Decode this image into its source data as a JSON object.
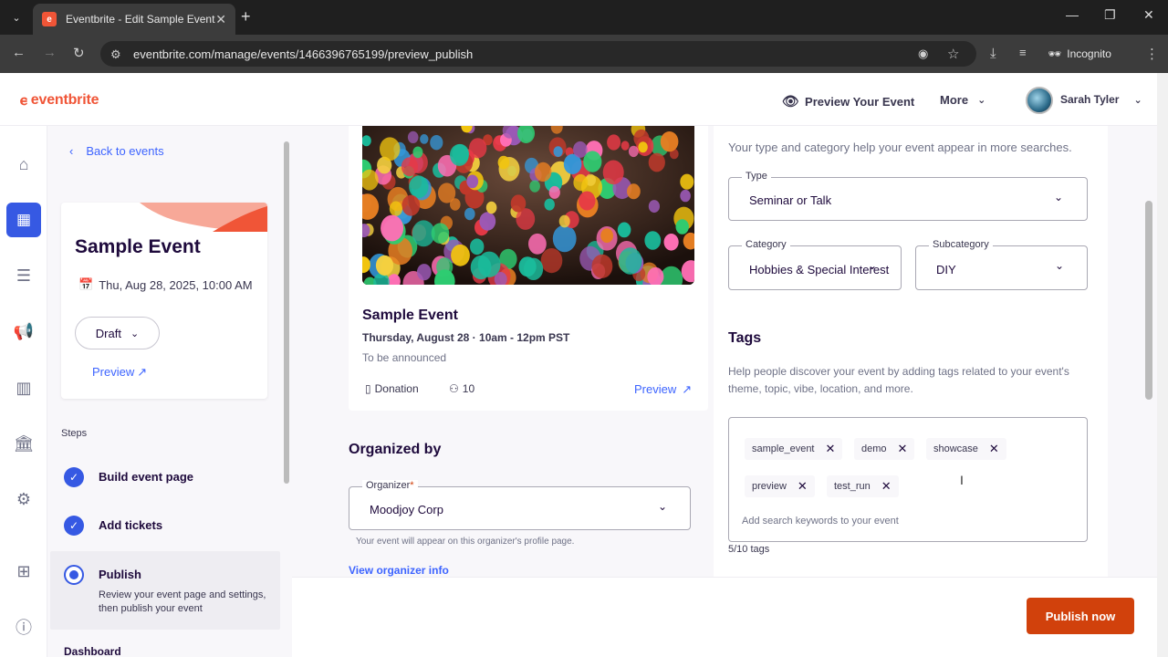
{
  "browser": {
    "tab_title": "Eventbrite - Edit Sample Event",
    "url": "eventbrite.com/manage/events/1466396765199/preview_publish",
    "incognito_label": "Incognito"
  },
  "header": {
    "logo": "eventbrite",
    "preview_event": "Preview Your Event",
    "more": "More",
    "user_name": "Sarah Tyler"
  },
  "sidebar": {
    "back_label": "Back to events",
    "event_title": "Sample Event",
    "event_date": "Thu, Aug 28, 2025, 10:00 AM",
    "status": "Draft",
    "preview_link": "Preview",
    "steps_label": "Steps",
    "steps": [
      {
        "title": "Build event page",
        "state": "done"
      },
      {
        "title": "Add tickets",
        "state": "done"
      },
      {
        "title": "Publish",
        "state": "current",
        "desc": "Review your event page and settings, then publish your event"
      }
    ],
    "dashboard_label": "Dashboard"
  },
  "preview_card": {
    "title": "Sample Event",
    "date": "Thursday, August 28 · 10am - 12pm PST",
    "location": "To be announced",
    "price": "Donation",
    "capacity": "10",
    "preview_link": "Preview"
  },
  "organizer": {
    "heading": "Organized by",
    "field_label": "Organizer",
    "required_mark": "*",
    "value": "Moodjoy Corp",
    "help": "Your event will appear on this organizer's profile page.",
    "link": "View organizer info"
  },
  "category": {
    "help": "Your type and category help your event appear in more searches.",
    "type_label": "Type",
    "type_value": "Seminar or Talk",
    "category_label": "Category",
    "category_value": "Hobbies & Special Interest",
    "subcategory_label": "Subcategory",
    "subcategory_value": "DIY"
  },
  "tags": {
    "heading": "Tags",
    "help": "Help people discover your event by adding tags related to your event's theme, topic, vibe, location, and more.",
    "items": [
      "sample_event",
      "demo",
      "showcase",
      "preview",
      "test_run"
    ],
    "placeholder": "Add search keywords to your event",
    "count": "5/10 tags"
  },
  "footer": {
    "publish_label": "Publish now"
  },
  "colors": {
    "brand": "#f05537",
    "accent_blue": "#3659e3",
    "link_blue": "#3d64ff",
    "publish": "#d1410c"
  }
}
